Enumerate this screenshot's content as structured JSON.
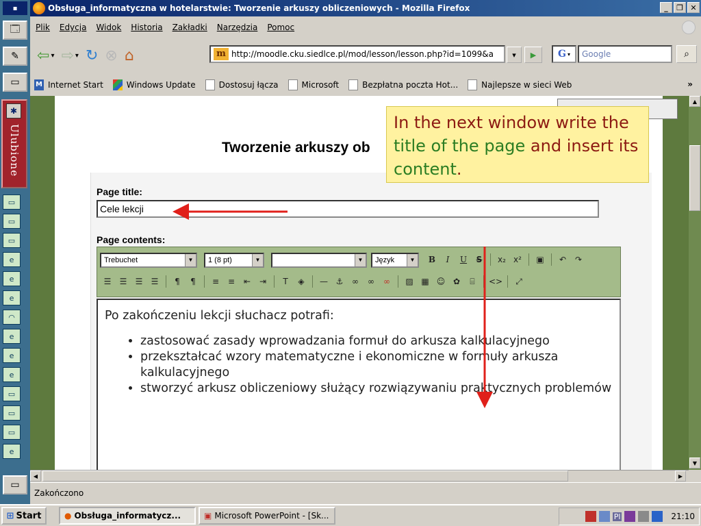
{
  "window": {
    "title": "Obsługa_informatyczna w hotelarstwie: Tworzenie arkuszy obliczeniowych - Mozilla Firefox"
  },
  "menu": {
    "items": [
      "Plik",
      "Edycja",
      "Widok",
      "Historia",
      "Zakładki",
      "Narzędzia",
      "Pomoc"
    ]
  },
  "nav": {
    "url": "http://moodle.cku.siedlce.pl/mod/lesson/lesson.php?id=1099&a",
    "search_placeholder": "Google",
    "search_engine_icon": "G"
  },
  "bookmarks": {
    "items": [
      "Internet Start",
      "Windows Update",
      "Dostosuj łącza",
      "Microsoft",
      "Bezpłatna poczta Hot...",
      "Najlepsze w sieci Web"
    ],
    "more": "»"
  },
  "sidebar": {
    "tab_label": "Ulubione"
  },
  "page": {
    "heading": "Tworzenie arkuszy ob",
    "title_label": "Page title:",
    "title_value": "Cele lekcji",
    "contents_label": "Page contents:"
  },
  "editor": {
    "font": "Trebuchet",
    "size": "1 (8 pt)",
    "style": "",
    "language": "Język",
    "buttons_row1": [
      "B",
      "I",
      "U",
      "S",
      "x₂",
      "x²",
      "↶",
      "↷"
    ],
    "intro": "Po zakończeniu lekcji słuchacz potrafi:",
    "bullets": [
      "zastosować zasady wprowadzania formuł do arkusza kalkulacyjnego",
      "przekształcać wzory matematyczne i ekonomiczne w formuły arkusza kalkulacyjnego",
      "stworzyć arkusz obliczeniowy służący rozwiązywaniu praktycznych problemów"
    ]
  },
  "callout": {
    "part1": "In the next window write the ",
    "part2": "title of the page",
    "part3": " and insert its ",
    "part4": "content",
    "part5": "."
  },
  "status": {
    "text": "Zakończono"
  },
  "taskbar": {
    "start": "Start",
    "tasks": [
      "Obsługa_informatycz...",
      "Microsoft PowerPoint - [Sk..."
    ],
    "tray_lang": "Pl",
    "clock": "21:10"
  },
  "colors": {
    "titlebar": "#0a246a",
    "callout_bg": "#fff2a0",
    "callout_red": "#8c1a12",
    "callout_green": "#2b7d23",
    "arrow": "#e0201a"
  }
}
